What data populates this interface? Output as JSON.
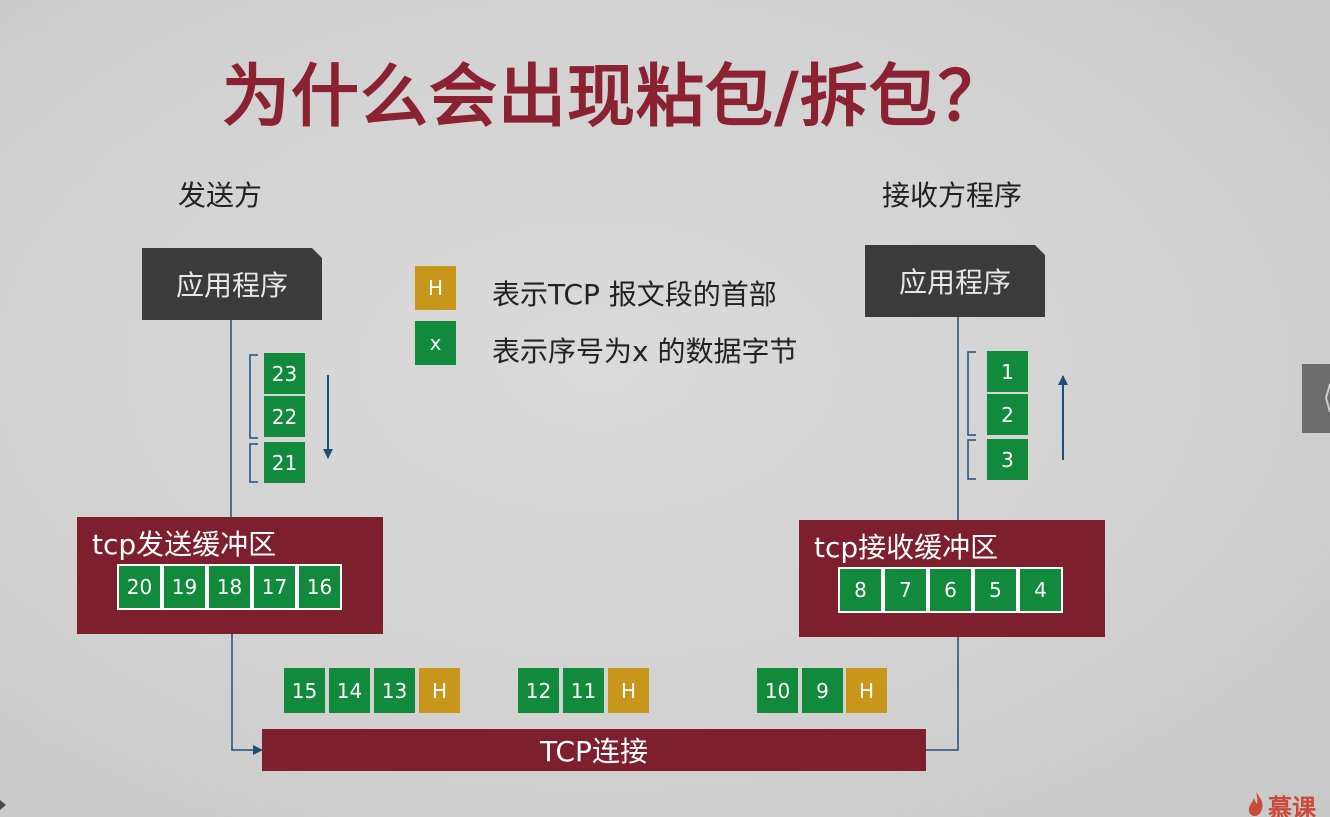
{
  "title": "为什么会出现粘包/拆包？",
  "sender": {
    "label": "发送方",
    "app": "应用程序",
    "stack": [
      "23",
      "22",
      "21"
    ],
    "buffer_label": "tcp发送缓冲区",
    "buffer_cells": [
      "20",
      "19",
      "18",
      "17",
      "16"
    ]
  },
  "receiver": {
    "label": "接收方程序",
    "app": "应用程序",
    "stack": [
      "1",
      "2",
      "3"
    ],
    "buffer_label": "tcp接收缓冲区",
    "buffer_cells": [
      "8",
      "7",
      "6",
      "5",
      "4"
    ]
  },
  "legend": {
    "h_symbol": "H",
    "h_text": "表示TCP 报文段的首部",
    "x_symbol": "x",
    "x_text": "表示序号为x 的数据字节"
  },
  "segments": [
    [
      "15",
      "14",
      "13",
      "H"
    ],
    [
      "12",
      "11",
      "H"
    ],
    [
      "10",
      "9",
      "H"
    ]
  ],
  "connection_label": "TCP连接",
  "colors": {
    "title": "#8b2231",
    "data_byte": "#118a3c",
    "header": "#c8961a",
    "buffer": "#7d1f2c",
    "app_box": "#3b3b3b",
    "arrow": "#1f4e79"
  },
  "logo": "慕课"
}
